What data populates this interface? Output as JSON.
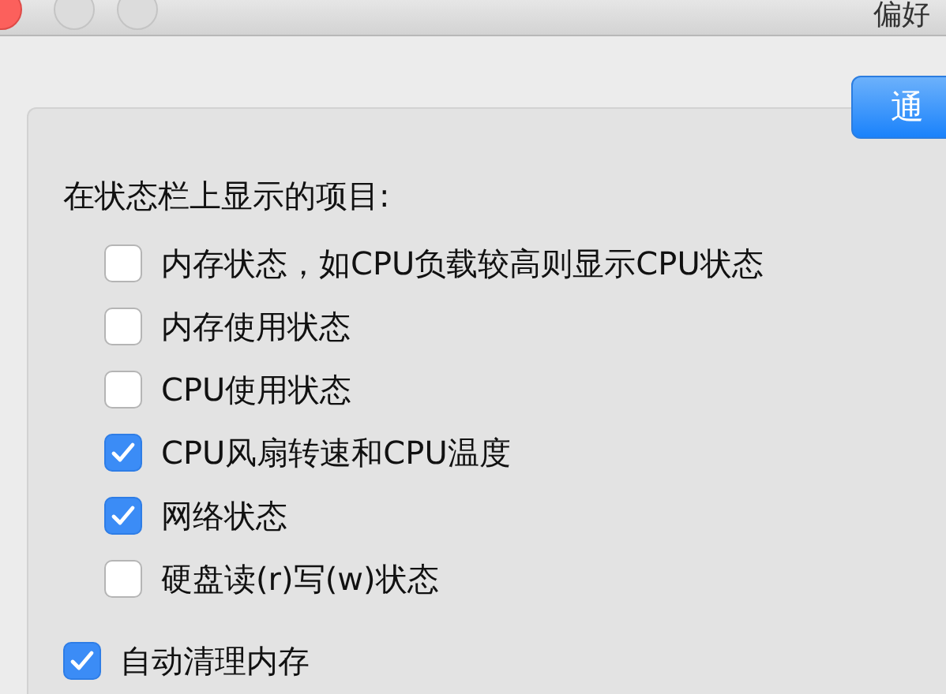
{
  "window": {
    "title": "偏好"
  },
  "tabs": [
    {
      "label": "通",
      "selected": true
    }
  ],
  "section": {
    "heading": "在状态栏上显示的项目:",
    "items": [
      {
        "label": "内存状态，如CPU负载较高则显示CPU状态",
        "checked": false
      },
      {
        "label": "内存使用状态",
        "checked": false
      },
      {
        "label": "CPU使用状态",
        "checked": false
      },
      {
        "label": "CPU风扇转速和CPU温度",
        "checked": true
      },
      {
        "label": "网络状态",
        "checked": true
      },
      {
        "label": "硬盘读(r)写(w)状态",
        "checked": false
      }
    ]
  },
  "options": [
    {
      "label": "自动清理内存",
      "checked": true
    }
  ]
}
